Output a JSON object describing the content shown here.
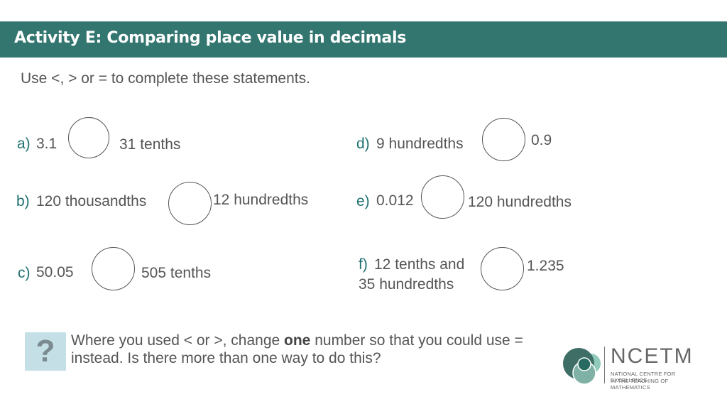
{
  "header": {
    "title": "Activity E: Comparing place value in decimals",
    "background_color": "#337670"
  },
  "instruction": "Use <, > or = to complete these statements.",
  "statements": [
    {
      "label": "a)",
      "left": "3.1",
      "right": "31 tenths",
      "answer": ""
    },
    {
      "label": "b)",
      "left": "120 thousandths",
      "right": "12 hundredths",
      "answer": ""
    },
    {
      "label": "c)",
      "left": "50.05",
      "right": "505 tenths",
      "answer": ""
    },
    {
      "label": "d)",
      "left": "9 hundredths",
      "right": "0.9",
      "answer": ""
    },
    {
      "label": "e)",
      "left": "0.012",
      "right": "120 hundredths",
      "answer": ""
    },
    {
      "label": "f)",
      "left_line1": "12 tenths and",
      "left_line2": "35 hundredths",
      "right": "1.235",
      "answer": ""
    }
  ],
  "question": {
    "icon": "question-mark-icon",
    "text_before": "Where you used < or >, change ",
    "text_bold": "one",
    "text_after": " number so that you could use = instead. Is there more than one way to do this?"
  },
  "logo": {
    "name": "NCETM",
    "line1": "NATIONAL CENTRE FOR EXCELLENCE",
    "line2": "IN THE TEACHING OF MATHEMATICS"
  }
}
